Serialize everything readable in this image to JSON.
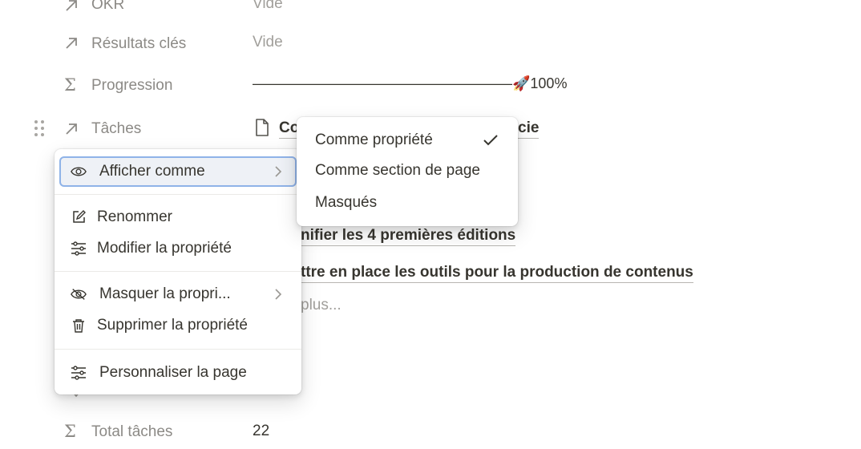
{
  "properties": [
    {
      "name": "OKR",
      "value": "Vide",
      "icon": "arrow-up-right-icon"
    },
    {
      "name": "Résultats clés",
      "value": "Vide",
      "icon": "arrow-up-right-icon"
    },
    {
      "name": "Progression",
      "value": "——————————————————🚀100%",
      "icon": "sigma-icon"
    },
    {
      "name": "Tâches",
      "icon": "arrow-up-right-icon"
    },
    {
      "name": "Total tâches",
      "value": "22",
      "icon": "sigma-icon"
    }
  ],
  "tasks": {
    "first_visible": "Co",
    "first_tail": "cie",
    "item_2": "nifier les 4 premières éditions",
    "item_3": "ttre en place les outils pour la production de contenus",
    "more": "plus..."
  },
  "context_menu": {
    "items": [
      {
        "label": "Afficher comme",
        "icon": "eye-icon",
        "has_submenu": true,
        "highlighted": true
      },
      {
        "label": "Renommer",
        "icon": "edit-icon"
      },
      {
        "label": "Modifier la propriété",
        "icon": "sliders-icon"
      },
      {
        "label": "Masquer la propri...",
        "icon": "eye-slash-icon",
        "has_submenu": true
      },
      {
        "label": "Supprimer la propriété",
        "icon": "trash-icon"
      },
      {
        "label": "Personnaliser la page",
        "icon": "sliders-icon"
      }
    ]
  },
  "submenu": {
    "items": [
      {
        "label": "Comme propriété",
        "checked": true
      },
      {
        "label": "Comme section de page",
        "checked": false
      },
      {
        "label": "Masqués",
        "checked": false
      }
    ]
  },
  "colors": {
    "highlight_border": "#8fb3e8",
    "text": "#37352f",
    "muted": "#8c8a86"
  }
}
